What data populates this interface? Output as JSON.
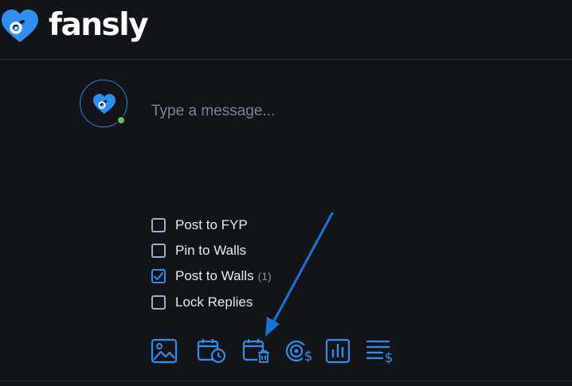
{
  "brand": {
    "name": "fansly",
    "accent": "#2f8ff0",
    "online": "#5cc166"
  },
  "composer": {
    "placeholder": "Type a message...",
    "options": [
      {
        "label": "Post to FYP",
        "checked": false,
        "count": ""
      },
      {
        "label": "Pin to Walls",
        "checked": false,
        "count": ""
      },
      {
        "label": "Post to Walls",
        "checked": true,
        "count": "(1)"
      },
      {
        "label": "Lock Replies",
        "checked": false,
        "count": ""
      }
    ],
    "toolbar": [
      "image-icon",
      "schedule-post-icon",
      "expire-post-icon",
      "tip-goal-icon",
      "poll-icon",
      "price-list-icon"
    ]
  },
  "annotation": {
    "color": "#1a73d9"
  }
}
